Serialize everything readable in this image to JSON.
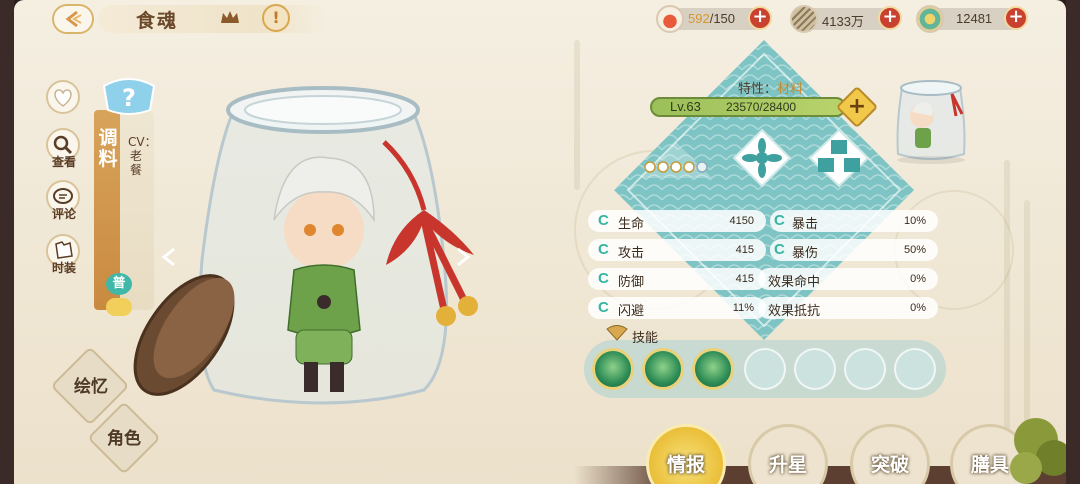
{
  "header": {
    "back_glyph": "◇",
    "title": "食魂",
    "warn_glyph": "!"
  },
  "resources": [
    {
      "name": "stamina",
      "current": "592",
      "max": "/150",
      "icon": "bowl-icon",
      "color": "#d9962e"
    },
    {
      "name": "gold",
      "value": "4133万",
      "icon": "coin-icon"
    },
    {
      "name": "jade",
      "value": "12481",
      "icon": "jade-icon"
    }
  ],
  "sidebar": {
    "items": [
      {
        "label": "",
        "icon": "heart-icon"
      },
      {
        "label": "查看",
        "icon": "magnify-icon"
      },
      {
        "label": "评论",
        "icon": "chat-icon"
      },
      {
        "label": "时装",
        "icon": "outfit-icon"
      }
    ]
  },
  "character": {
    "name": "调料",
    "cv": "CV：老餐",
    "rarity": "普"
  },
  "buttons": {
    "gallery": "绘忆",
    "role": "角色"
  },
  "info": {
    "trait_label": "特性：",
    "trait_value": "材料",
    "level": "Lv.63",
    "exp": "23570/28400"
  },
  "stats": [
    {
      "name": "生命",
      "value": "4150"
    },
    {
      "name": "暴击",
      "value": "10%"
    },
    {
      "name": "攻击",
      "value": "415"
    },
    {
      "name": "暴伤",
      "value": "50%"
    },
    {
      "name": "防御",
      "value": "415"
    },
    {
      "name": "效果命中",
      "value": "0%"
    },
    {
      "name": "闪避",
      "value": "11%"
    },
    {
      "name": "效果抵抗",
      "value": "0%"
    }
  ],
  "stat_mark": "C",
  "skills": {
    "label": "技能",
    "unlocked": 3,
    "total": 8
  },
  "tabs": [
    {
      "label": "情报",
      "active": true
    },
    {
      "label": "升星",
      "active": false
    },
    {
      "label": "突破",
      "active": false
    },
    {
      "label": "膳具",
      "active": false
    }
  ],
  "colors": {
    "teal": "#7fc4c4",
    "gold": "#e8b92f",
    "red_ribbon": "#c8352c",
    "accent_green": "#35b5a2"
  }
}
